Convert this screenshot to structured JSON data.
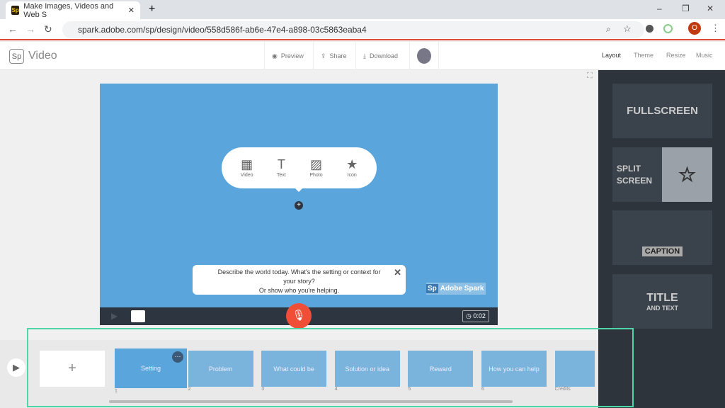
{
  "browser": {
    "tab_title": "Make Images, Videos and Web S",
    "url": "spark.adobe.com/sp/design/video/558d586f-ab6e-47e4-a898-03c5863eaba4",
    "profile": "O"
  },
  "app": {
    "logo": "Sp",
    "title": "Video",
    "preview": "Preview",
    "share": "Share",
    "download": "Download",
    "nav": [
      "Layout",
      "Theme",
      "Resize",
      "Music"
    ]
  },
  "layouts": {
    "fullscreen": "FULLSCREEN",
    "split": "SPLIT SCREEN",
    "caption": "CAPTION",
    "title": "TITLE",
    "title_sub": "AND TEXT"
  },
  "menu": [
    {
      "label": "Video",
      "icon": "film-icon"
    },
    {
      "label": "Text",
      "icon": "text-icon"
    },
    {
      "label": "Photo",
      "icon": "photo-icon"
    },
    {
      "label": "Icon",
      "icon": "star-icon"
    }
  ],
  "tip": {
    "line1": "Describe the world today. What's the setting or context for",
    "line2": "your story?",
    "line3": "Or show who you're helping."
  },
  "watermark": "Adobe Spark",
  "duration": "0:02",
  "slides": [
    {
      "label": "Setting",
      "num": "1"
    },
    {
      "label": "Problem",
      "num": "2"
    },
    {
      "label": "What could be",
      "num": "3"
    },
    {
      "label": "Solution or idea",
      "num": "4"
    },
    {
      "label": "Reward",
      "num": "5"
    },
    {
      "label": "How you can help",
      "num": "6"
    },
    {
      "label": "",
      "num": "Credits"
    }
  ],
  "colors": {
    "accent": "#5aa6dc",
    "record": "#f04e37",
    "highlight": "#4fd6a8"
  }
}
